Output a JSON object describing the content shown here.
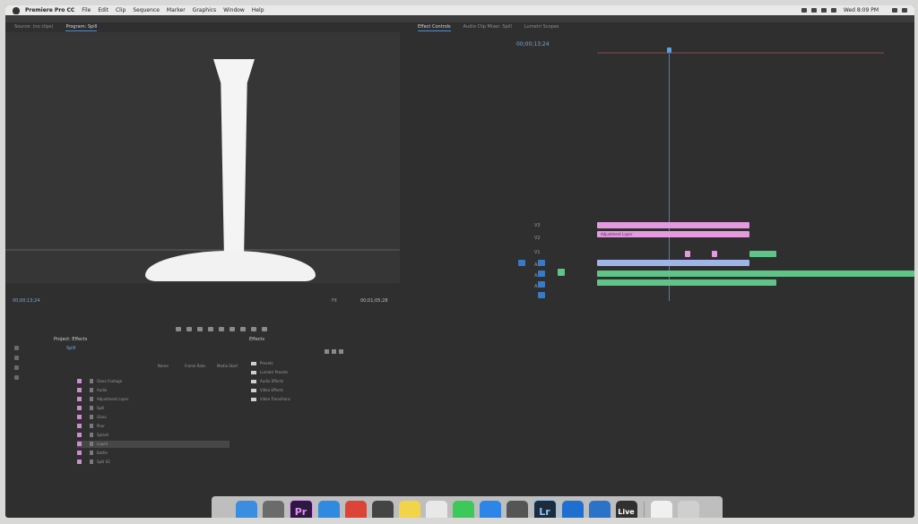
{
  "menubar": {
    "app_name": "Premiere Pro CC",
    "items": [
      "File",
      "Edit",
      "Clip",
      "Sequence",
      "Marker",
      "Graphics",
      "Window",
      "Help"
    ],
    "clock": "Wed 8:09 PM"
  },
  "top_tabs": {
    "left": [
      "Source: (no clips)",
      "Program: Spill"
    ],
    "right": [
      "Effect Controls",
      "Audio Clip Mixer: Spill",
      "Lumetri Scopes"
    ]
  },
  "timeline": {
    "timecode": "00;00;13;24",
    "tracks": [
      "V3",
      "V2",
      "V1",
      "A1",
      "A2",
      "A3"
    ],
    "clip_labels": [
      "Adjustment Layer"
    ]
  },
  "program_monitor": {
    "timecode_left": "00;00;13;24",
    "fit_label": "Fit",
    "timecode_right": "00;01;05;28"
  },
  "project": {
    "title": "Project: Effects",
    "sequence": "Spill",
    "columns": [
      "Name",
      "Frame Rate",
      "Media Start"
    ],
    "items": [
      "Glass Footage",
      "Audio",
      "Adjustment Layer",
      "Spill",
      "Glass",
      "Pour",
      "Splash",
      "Liquid",
      "Bottle",
      "Spill 02"
    ]
  },
  "effects": {
    "title": "Effects",
    "folders": [
      "Presets",
      "Lumetri Presets",
      "Audio Effects",
      "Video Effects",
      "Video Transitions"
    ]
  },
  "dock": {
    "apps": [
      {
        "name": "finder",
        "label": "",
        "color": "#3a8de0"
      },
      {
        "name": "launchpad",
        "label": "",
        "color": "#6b6b6b"
      },
      {
        "name": "premiere",
        "label": "Pr",
        "color": "#2a1a3e"
      },
      {
        "name": "safari",
        "label": "",
        "color": "#2f8ae0"
      },
      {
        "name": "chrome",
        "label": "",
        "color": "#db4437"
      },
      {
        "name": "final-cut",
        "label": "",
        "color": "#444444"
      },
      {
        "name": "notes",
        "label": "",
        "color": "#f3d34a"
      },
      {
        "name": "textedit",
        "label": "",
        "color": "#e8e8e8"
      },
      {
        "name": "messages",
        "label": "",
        "color": "#3dc85a"
      },
      {
        "name": "app-store",
        "label": "",
        "color": "#2b86e8"
      },
      {
        "name": "time-machine",
        "label": "",
        "color": "#555555"
      },
      {
        "name": "lightroom",
        "label": "Lr",
        "color": "#1e2b3a"
      },
      {
        "name": "quicktime",
        "label": "",
        "color": "#1f6fd1"
      },
      {
        "name": "security",
        "label": "",
        "color": "#2a73c9"
      },
      {
        "name": "ableton-live",
        "label": "Live",
        "color": "#303030"
      },
      {
        "name": "documents",
        "label": "",
        "color": "#f0f0f0"
      },
      {
        "name": "trash",
        "label": "",
        "color": "#cfcfcf"
      }
    ]
  }
}
